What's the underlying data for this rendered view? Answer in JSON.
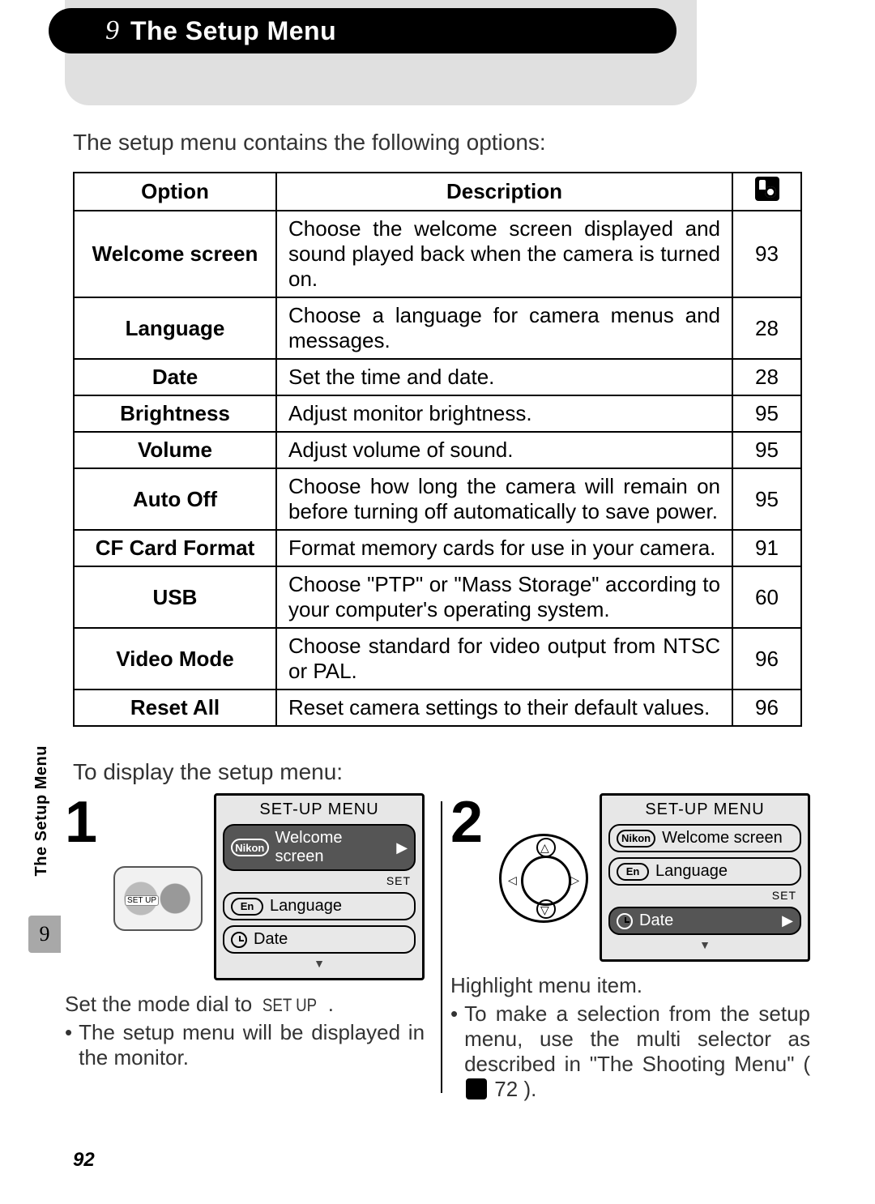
{
  "header": {
    "glyph": "9",
    "title": "The Setup Menu"
  },
  "intro": "The setup menu contains the following options:",
  "table": {
    "headers": {
      "option": "Option",
      "description": "Description"
    },
    "rows": [
      {
        "option": "Welcome screen",
        "description": "Choose the welcome screen displayed and sound played back when the camera is turned on.",
        "page": "93"
      },
      {
        "option": "Language",
        "description": "Choose a language for camera menus and messages.",
        "page": "28"
      },
      {
        "option": "Date",
        "description": "Set the time and date.",
        "page": "28"
      },
      {
        "option": "Brightness",
        "description": "Adjust monitor brightness.",
        "page": "95"
      },
      {
        "option": "Volume",
        "description": "Adjust volume of sound.",
        "page": "95"
      },
      {
        "option": "Auto Off",
        "description": "Choose how long the camera will remain on before turning off automatically to save power.",
        "page": "95"
      },
      {
        "option": "CF Card Format",
        "description": "Format memory cards for use in your camera.",
        "page": "91"
      },
      {
        "option": "USB",
        "description": "Choose \"PTP\" or \"Mass Storage\" according to your computer's operating system.",
        "page": "60"
      },
      {
        "option": "Video Mode",
        "description": "Choose standard for video output from NTSC or PAL.",
        "page": "96"
      },
      {
        "option": "Reset All",
        "description": "Reset camera settings to their default values.",
        "page": "96"
      }
    ]
  },
  "subtitle": "To display the setup menu:",
  "lcd": {
    "title": "SET-UP MENU",
    "rows": [
      {
        "tag": "Nikon",
        "label": "Welcome screen"
      },
      {
        "tag": "En",
        "label": "Language"
      },
      {
        "tag": "clock",
        "label": "Date"
      }
    ],
    "set": "SET"
  },
  "steps": {
    "one": {
      "num": "1",
      "dial_label": "SET UP",
      "caption_lead": "Set the mode dial to ",
      "caption_glyph": "SET UP",
      "caption_tail": ".",
      "bullet": "The setup menu will be displayed in the monitor."
    },
    "two": {
      "num": "2",
      "caption_lead": "Highlight menu item.",
      "bullet_a": "To make a selection from the setup menu, use the multi selector as described in \"The Shooting Menu\" (",
      "bullet_ref": "72",
      "bullet_b": ")."
    }
  },
  "side": {
    "label": "The Setup Menu",
    "glyph": "9"
  },
  "page_number": "92"
}
